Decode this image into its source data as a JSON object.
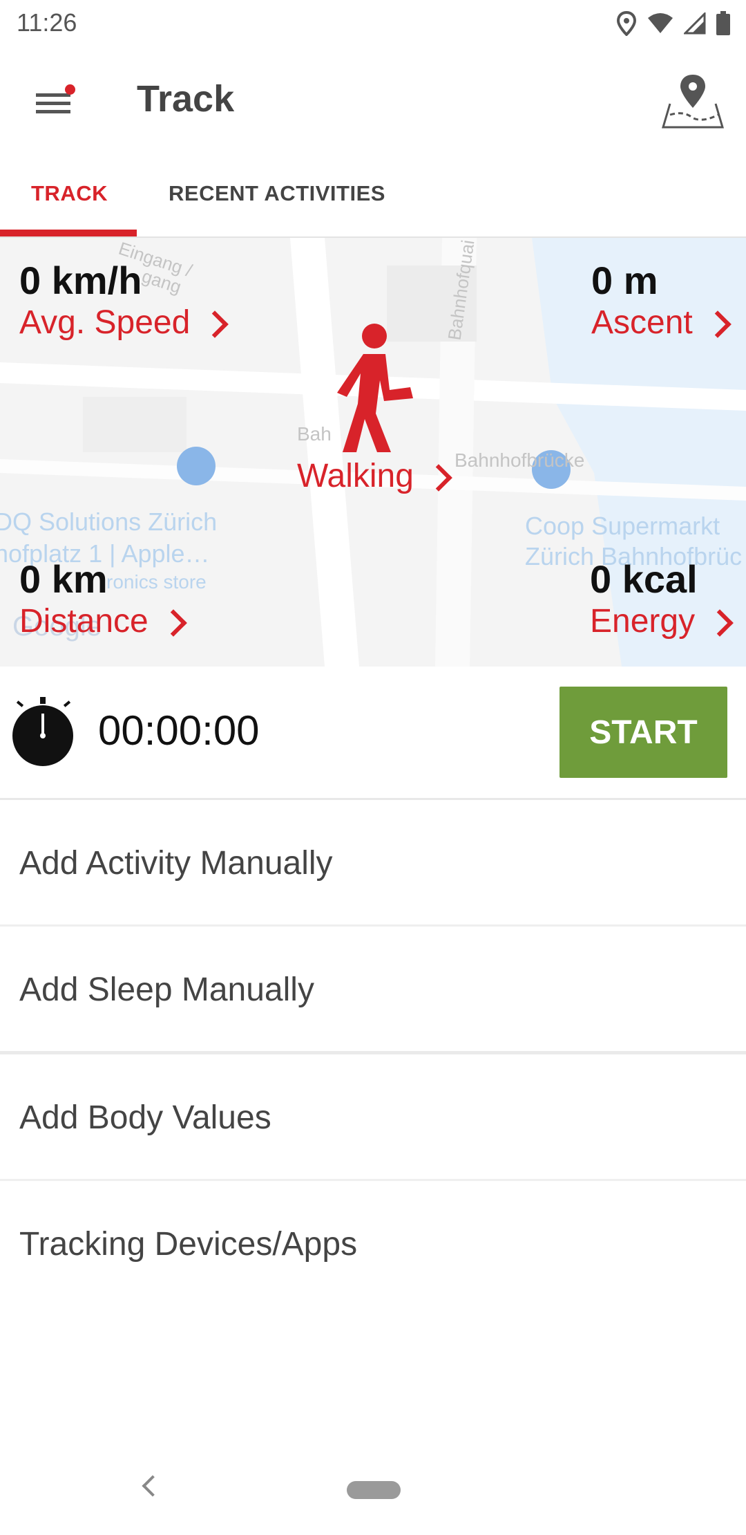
{
  "status_bar": {
    "time": "11:26"
  },
  "app_bar": {
    "title": "Track"
  },
  "tabs": [
    {
      "label": "TRACK",
      "active": true
    },
    {
      "label": "RECENT ACTIVITIES",
      "active": false
    }
  ],
  "map": {
    "labels": {
      "eingang": "Eingang /",
      "gang": "gang",
      "bahnhofquai": "Bahnhofquai",
      "bah": "Bah",
      "bahnhofbrucke": "Bahnhofbrücke",
      "dq_solutions": "DQ Solutions Zürich",
      "hofplatz": "hofplatz 1 | Apple…",
      "electronics": "ronics store",
      "coop": "Coop Supermarkt",
      "coop_zurich": "Zürich Bahnhofbrüc",
      "google": "Google"
    }
  },
  "stats": {
    "avg_speed": {
      "value": "0 km/h",
      "label": "Avg. Speed"
    },
    "ascent": {
      "value": "0 m",
      "label": "Ascent"
    },
    "distance": {
      "value": "0 km",
      "label": "Distance"
    },
    "energy": {
      "value": "0 kcal",
      "label": "Energy"
    },
    "activity": {
      "label": "Walking"
    }
  },
  "timer": {
    "value": "00:00:00",
    "start_label": "START"
  },
  "actions": [
    {
      "label": "Add Activity Manually"
    },
    {
      "label": "Add Sleep Manually"
    },
    {
      "label": "Add Body Values"
    },
    {
      "label": "Tracking Devices/Apps"
    }
  ],
  "colors": {
    "accent": "#d8232a",
    "start": "#6f9c3b",
    "water": "#e6f1fb"
  },
  "icons": [
    "menu-icon",
    "map-pin-icon",
    "walking-icon",
    "stopwatch-icon",
    "location-icon",
    "wifi-icon",
    "cell-signal-icon",
    "battery-icon",
    "back-icon"
  ]
}
